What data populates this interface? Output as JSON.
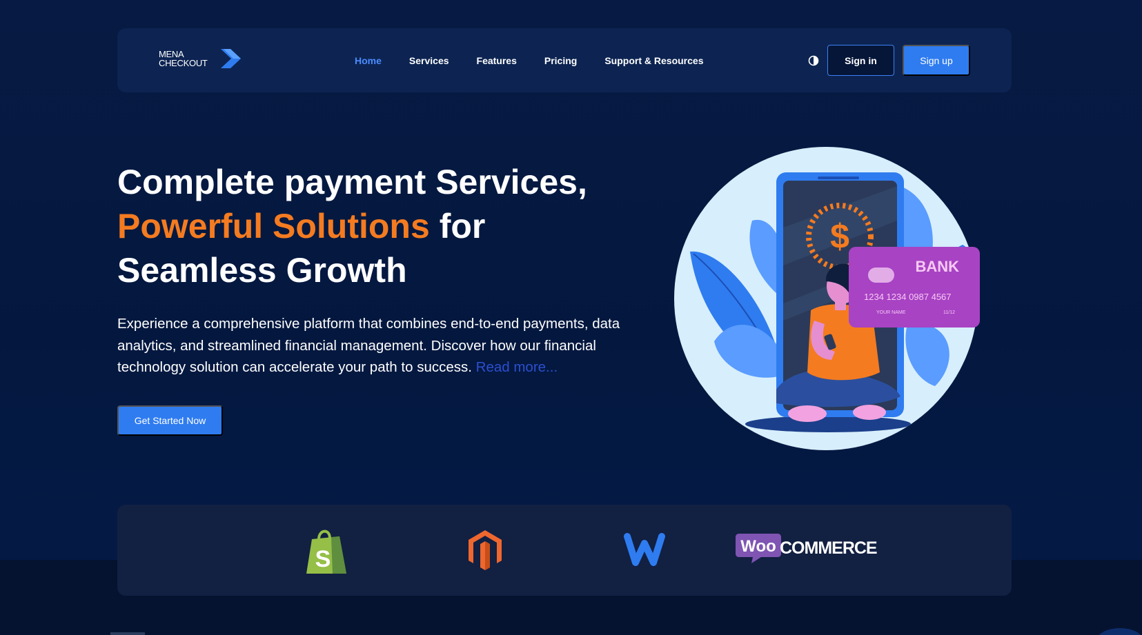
{
  "brand": {
    "line1": "MENA",
    "line2": "CHECKOUT",
    "logo_icon": "chevron-logo-icon"
  },
  "nav": {
    "items": [
      {
        "label": "Home",
        "active": true
      },
      {
        "label": "Services",
        "active": false
      },
      {
        "label": "Features",
        "active": false
      },
      {
        "label": "Pricing",
        "active": false
      },
      {
        "label": "Support & Resources",
        "active": false
      }
    ],
    "theme_icon": "contrast-icon",
    "signin_label": "Sign in",
    "signup_label": "Sign up"
  },
  "hero": {
    "title_line1": "Complete payment Services,",
    "title_accent": "Powerful Solutions",
    "title_after_accent": " for",
    "title_line3": "Seamless Growth",
    "description": "Experience a comprehensive platform that combines end-to-end payments, data analytics, and streamlined financial management. Discover how our financial technology solution can accelerate your path to success. ",
    "read_more": "Read more...",
    "cta_label": "Get Started Now"
  },
  "illustration": {
    "card_bank": "BANK",
    "card_number": "1234 1234 0987 4567",
    "card_name": "YOUR NAME",
    "card_expiry": "11/12",
    "currency_symbol": "$"
  },
  "partners": [
    {
      "name": "shopify",
      "icon": "shopify-logo-icon",
      "glyph": "S"
    },
    {
      "name": "magento",
      "icon": "magento-logo-icon"
    },
    {
      "name": "weebly",
      "icon": "weebly-logo-icon"
    },
    {
      "name": "woocommerce",
      "icon": "woocommerce-logo-icon",
      "badge": "Woo",
      "text": "COMMERCE"
    }
  ],
  "colors": {
    "background": "#04183f",
    "navbar": "#0d2452",
    "accent_orange": "#f47b20",
    "primary_blue": "#2f7cf0",
    "active_link": "#4a8cff",
    "partners_bar": "#122042"
  }
}
